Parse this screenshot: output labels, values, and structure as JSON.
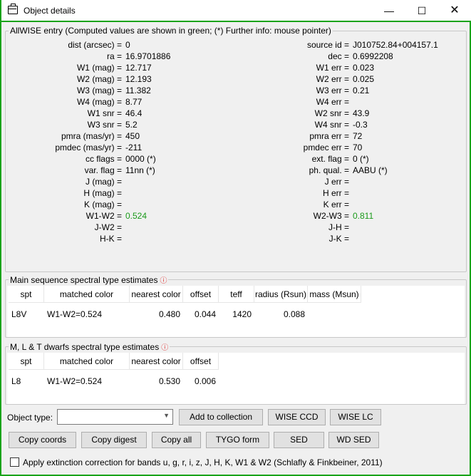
{
  "window": {
    "title": "Object details",
    "icon": "window-icon"
  },
  "allwise": {
    "legend": "AllWISE entry (Computed values are shown in green; (*) Further info: mouse pointer)",
    "left": [
      {
        "label": "dist (arcsec) =",
        "value": "0"
      },
      {
        "label": "ra =",
        "value": "16.9701886"
      },
      {
        "label": "W1 (mag) =",
        "value": "12.717"
      },
      {
        "label": "W2 (mag) =",
        "value": "12.193"
      },
      {
        "label": "W3 (mag) =",
        "value": "11.382"
      },
      {
        "label": "W4 (mag) =",
        "value": "8.77"
      },
      {
        "label": "W1 snr =",
        "value": "46.4"
      },
      {
        "label": "W3 snr =",
        "value": "5.2"
      },
      {
        "label": "pmra (mas/yr) =",
        "value": "450"
      },
      {
        "label": "pmdec (mas/yr) =",
        "value": "-211"
      },
      {
        "label": "cc flags =",
        "value": "0000 (*)"
      },
      {
        "label": "var. flag =",
        "value": "11nn (*)"
      },
      {
        "label": "J (mag) =",
        "value": ""
      },
      {
        "label": "H (mag) =",
        "value": ""
      },
      {
        "label": "K (mag) =",
        "value": ""
      },
      {
        "label": "W1-W2 =",
        "value": "0.524",
        "computed": true
      },
      {
        "label": "J-W2 =",
        "value": ""
      },
      {
        "label": "H-K =",
        "value": ""
      }
    ],
    "right": [
      {
        "label": "source id =",
        "value": "J010752.84+004157.1"
      },
      {
        "label": "dec =",
        "value": "0.6992208"
      },
      {
        "label": "W1 err =",
        "value": "0.023"
      },
      {
        "label": "W2 err =",
        "value": "0.025"
      },
      {
        "label": "W3 err =",
        "value": "0.21"
      },
      {
        "label": "W4 err =",
        "value": ""
      },
      {
        "label": "W2 snr =",
        "value": "43.9"
      },
      {
        "label": "W4 snr =",
        "value": "-0.3"
      },
      {
        "label": "pmra err =",
        "value": "72"
      },
      {
        "label": "pmdec err =",
        "value": "70"
      },
      {
        "label": "ext. flag =",
        "value": "0 (*)"
      },
      {
        "label": "ph. qual. =",
        "value": "AABU (*)"
      },
      {
        "label": "J err =",
        "value": ""
      },
      {
        "label": "H err =",
        "value": ""
      },
      {
        "label": "K err =",
        "value": ""
      },
      {
        "label": "W2-W3 =",
        "value": "0.811",
        "computed": true
      },
      {
        "label": "J-H =",
        "value": ""
      },
      {
        "label": "J-K =",
        "value": ""
      }
    ]
  },
  "main_seq": {
    "legend": "Main sequence spectral type estimates",
    "columns": [
      "spt",
      "matched color",
      "nearest color",
      "offset",
      "teff",
      "radius (Rsun)",
      "mass (Msun)"
    ],
    "rows": [
      [
        "L8V",
        "W1-W2=0.524",
        "0.480",
        "0.044",
        "1420",
        "0.088",
        ""
      ]
    ]
  },
  "mlt": {
    "legend": "M, L & T dwarfs spectral type estimates",
    "columns": [
      "spt",
      "matched color",
      "nearest color",
      "offset"
    ],
    "rows": [
      [
        "L8",
        "W1-W2=0.524",
        "0.530",
        "0.006"
      ]
    ]
  },
  "controls": {
    "object_type_label": "Object type:",
    "object_type_value": "",
    "add_to_collection": "Add to collection",
    "wise_ccd": "WISE CCD",
    "wise_lc": "WISE LC",
    "copy_coords": "Copy coords",
    "copy_digest": "Copy digest",
    "copy_all": "Copy all",
    "tygo_form": "TYGO form",
    "sed": "SED",
    "wd_sed": "WD SED",
    "extinction_label": "Apply extinction correction for bands u, g, r, i, z, J, H, K, W1 & W2 (Schlafly & Finkbeiner, 2011)",
    "extinction_checked": false
  },
  "colors": {
    "computed": "#1a9a1a",
    "border": "#1aa31a",
    "info": "#d22222"
  }
}
